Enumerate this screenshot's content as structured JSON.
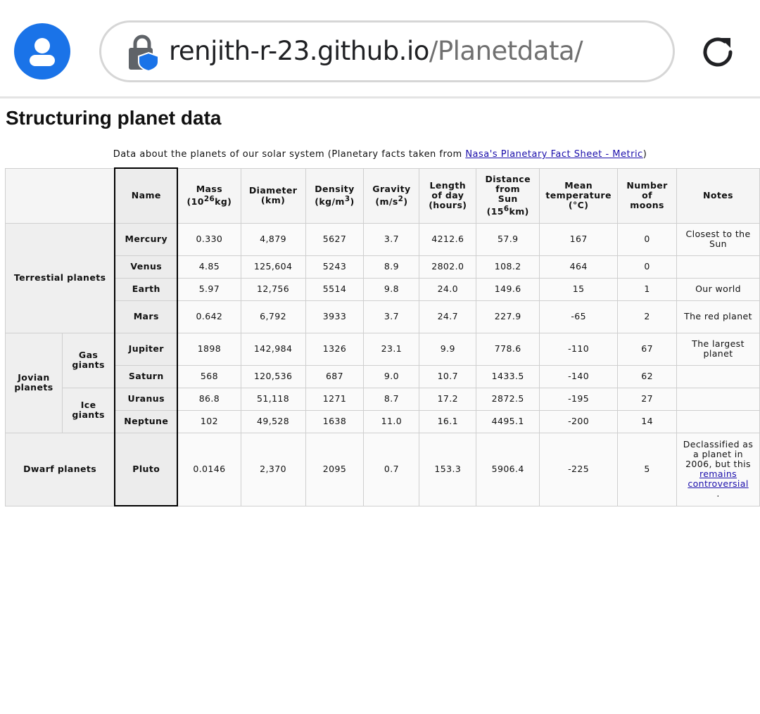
{
  "browser": {
    "url_host": "renjith-r-23.github.io",
    "url_path": "/Planetdata/"
  },
  "page": {
    "title": "Structuring planet data",
    "caption_prefix": "Data about the planets of our solar system (Planetary facts taken from ",
    "caption_link": "Nasa's Planetary Fact Sheet - Metric",
    "caption_suffix": ")"
  },
  "table": {
    "headers": {
      "name": "Name",
      "mass_a": "Mass",
      "mass_b": "(10",
      "mass_sup": "26",
      "mass_c": "kg)",
      "diameter_a": "Diameter",
      "diameter_b": "(km)",
      "density_a": "Density",
      "density_b": "(kg/m",
      "density_sup": "3",
      "density_c": ")",
      "gravity_a": "Gravity",
      "gravity_b": "(m/s",
      "gravity_sup": "2",
      "gravity_c": ")",
      "length_a": "Length",
      "length_b": "of day",
      "length_c": "(hours)",
      "distance_a": "Distance",
      "distance_b": "from",
      "distance_c": "Sun",
      "distance_d": "(15",
      "distance_sup": "6",
      "distance_e": "km)",
      "temp_a": "Mean",
      "temp_b": "temperature",
      "temp_c": "(°C)",
      "moons_a": "Number",
      "moons_b": "of",
      "moons_c": "moons",
      "notes": "Notes"
    },
    "groups": {
      "terrestrial": "Terrestial planets",
      "jovian": "Jovian planets",
      "gas": "Gas giants",
      "ice": "Ice giants",
      "dwarf": "Dwarf planets"
    },
    "rows": [
      {
        "name": "Mercury",
        "mass": "0.330",
        "diameter": "4,879",
        "density": "5627",
        "gravity": "3.7",
        "day": "4212.6",
        "distance": "57.9",
        "temp": "167",
        "moons": "0",
        "notes": "Closest to the Sun"
      },
      {
        "name": "Venus",
        "mass": "4.85",
        "diameter": "125,604",
        "density": "5243",
        "gravity": "8.9",
        "day": "2802.0",
        "distance": "108.2",
        "temp": "464",
        "moons": "0",
        "notes": ""
      },
      {
        "name": "Earth",
        "mass": "5.97",
        "diameter": "12,756",
        "density": "5514",
        "gravity": "9.8",
        "day": "24.0",
        "distance": "149.6",
        "temp": "15",
        "moons": "1",
        "notes": "Our world"
      },
      {
        "name": "Mars",
        "mass": "0.642",
        "diameter": "6,792",
        "density": "3933",
        "gravity": "3.7",
        "day": "24.7",
        "distance": "227.9",
        "temp": "-65",
        "moons": "2",
        "notes": "The red planet"
      },
      {
        "name": "Jupiter",
        "mass": "1898",
        "diameter": "142,984",
        "density": "1326",
        "gravity": "23.1",
        "day": "9.9",
        "distance": "778.6",
        "temp": "-110",
        "moons": "67",
        "notes": "The largest planet"
      },
      {
        "name": "Saturn",
        "mass": "568",
        "diameter": "120,536",
        "density": "687",
        "gravity": "9.0",
        "day": "10.7",
        "distance": "1433.5",
        "temp": "-140",
        "moons": "62",
        "notes": ""
      },
      {
        "name": "Uranus",
        "mass": "86.8",
        "diameter": "51,118",
        "density": "1271",
        "gravity": "8.7",
        "day": "17.2",
        "distance": "2872.5",
        "temp": "-195",
        "moons": "27",
        "notes": ""
      },
      {
        "name": "Neptune",
        "mass": "102",
        "diameter": "49,528",
        "density": "1638",
        "gravity": "11.0",
        "day": "16.1",
        "distance": "4495.1",
        "temp": "-200",
        "moons": "14",
        "notes": ""
      },
      {
        "name": "Pluto",
        "mass": "0.0146",
        "diameter": "2,370",
        "density": "2095",
        "gravity": "0.7",
        "day": "153.3",
        "distance": "5906.4",
        "temp": "-225",
        "moons": "5",
        "notes": "Declassified as a planet in 2006, but this ",
        "notes_link": "remains controversial",
        "notes_end": "."
      }
    ]
  }
}
